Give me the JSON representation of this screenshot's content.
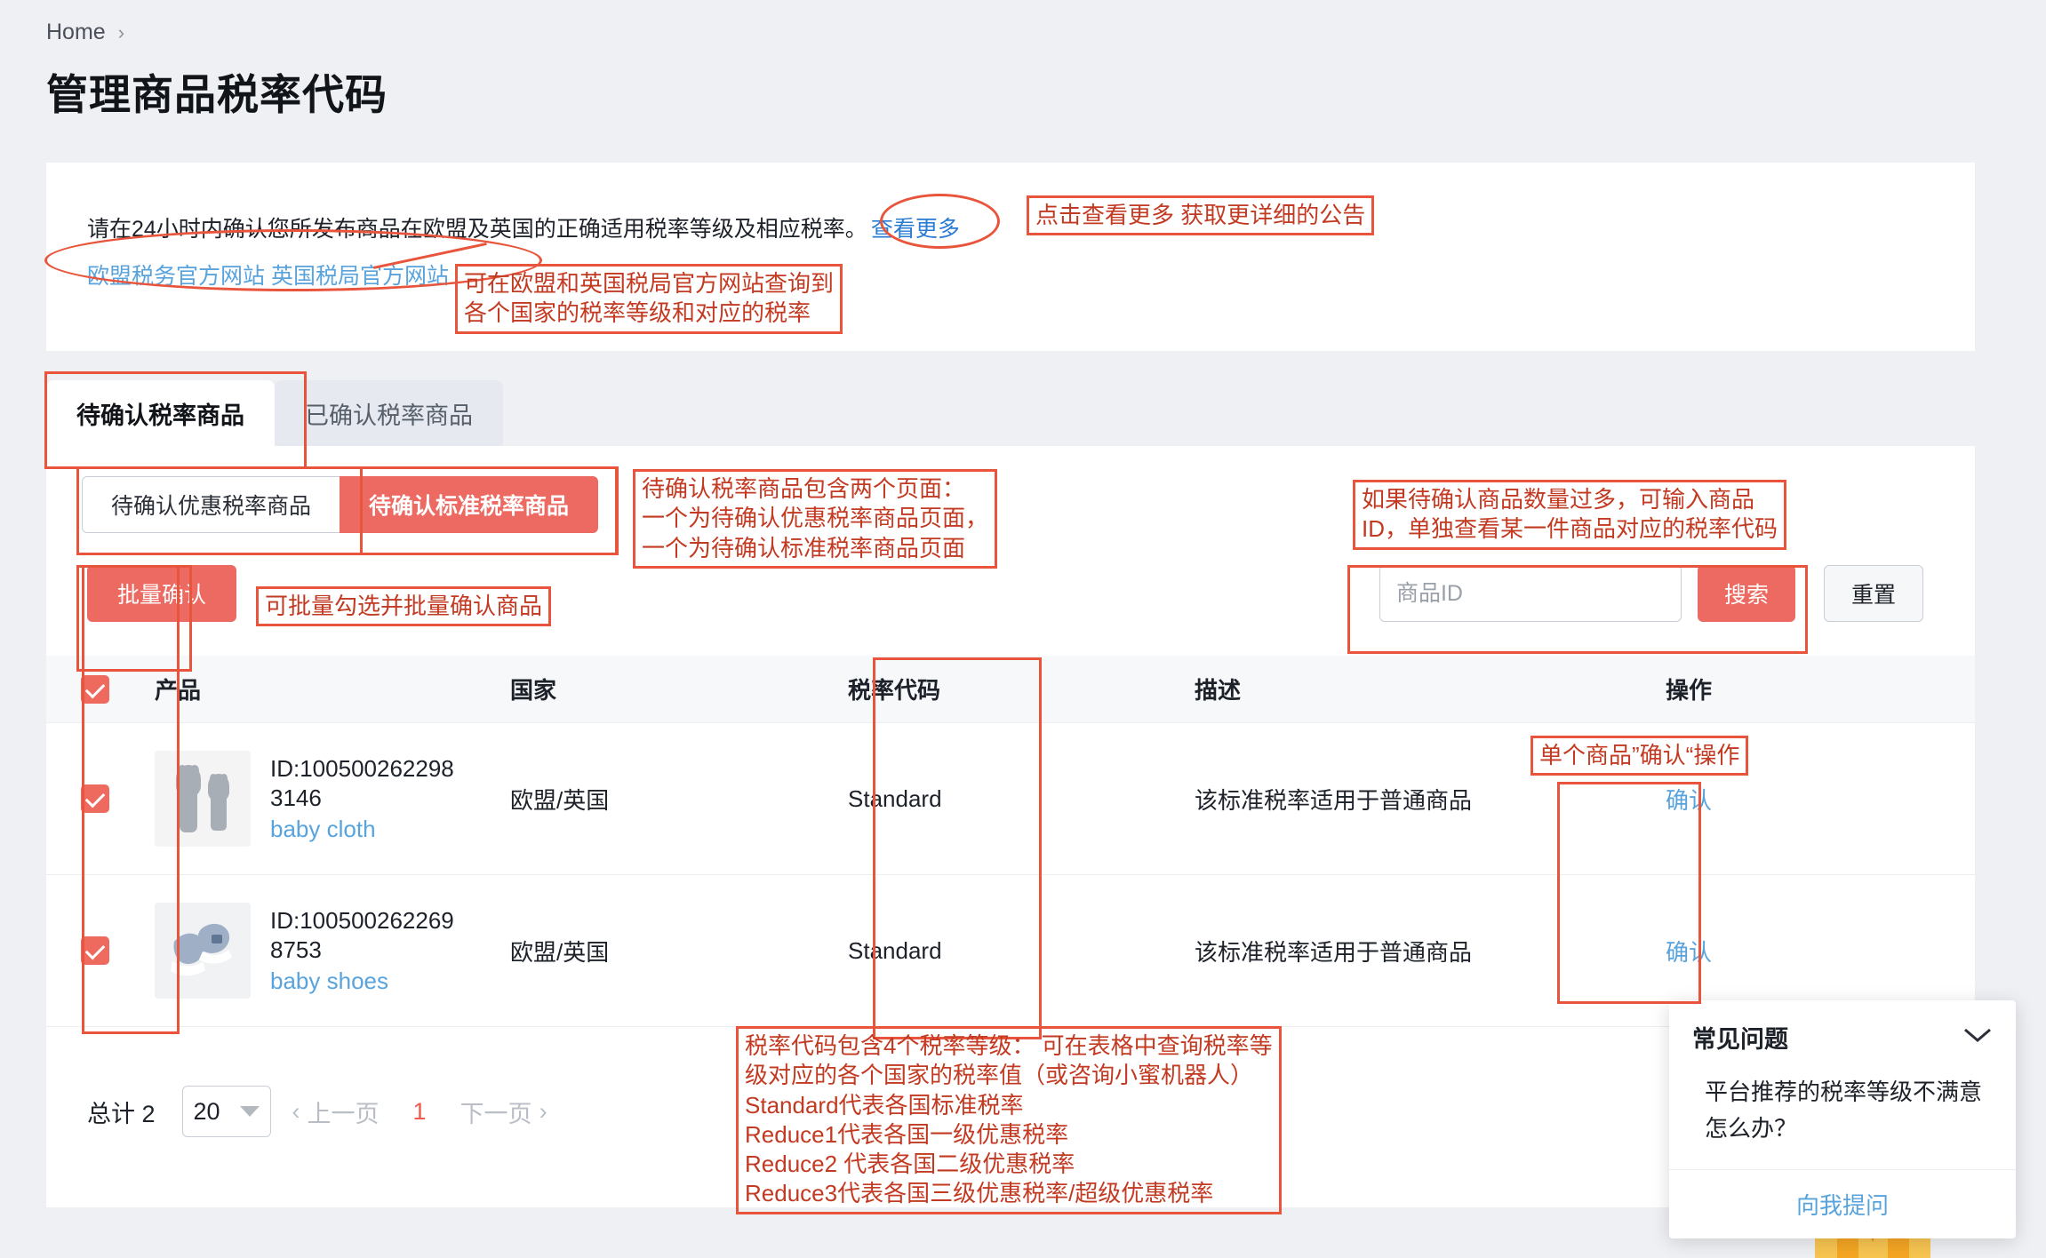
{
  "breadcrumb": {
    "home": "Home",
    "chevron": "›"
  },
  "page_title": "管理商品税率代码",
  "notice": {
    "text": "请在24小时内确认您所发布商品在欧盟及英国的正确适用税率等级及相应税率。",
    "more_link": "查看更多",
    "link_eu": "欧盟税务官方网站",
    "link_uk": "英国税局官方网站"
  },
  "tabs": [
    {
      "label": "待确认税率商品",
      "active": true
    },
    {
      "label": "已确认税率商品",
      "active": false
    }
  ],
  "subtabs": [
    {
      "label": "待确认优惠税率商品",
      "active": false
    },
    {
      "label": "待确认标准税率商品",
      "active": true
    }
  ],
  "toolbar": {
    "batch_confirm": "批量确认",
    "search_placeholder": "商品ID",
    "search_value": "",
    "search_button": "搜索",
    "reset_button": "重置"
  },
  "table": {
    "columns": [
      "产品",
      "国家",
      "税率代码",
      "描述",
      "操作"
    ],
    "rows": [
      {
        "checked": true,
        "id_label": "ID:1005002622983146",
        "name": "baby cloth",
        "country": "欧盟/英国",
        "tax_code": "Standard",
        "description": "该标准税率适用于普通商品",
        "action": "确认"
      },
      {
        "checked": true,
        "id_label": "ID:1005002622698753",
        "name": "baby shoes",
        "country": "欧盟/英国",
        "tax_code": "Standard",
        "description": "该标准税率适用于普通商品",
        "action": "确认"
      }
    ],
    "header_checked": true
  },
  "pagination": {
    "total_label": "总计 2",
    "page_size": "20",
    "prev": "上一页",
    "current_page": "1",
    "next": "下一页"
  },
  "faq": {
    "title": "常见问题",
    "question": "平台推荐的税率等级不满意怎么办？",
    "ask_link": "向我提问"
  },
  "annotations": {
    "a1": "点击查看更多 获取更详细的公告",
    "a2": "可在欧盟和英国税局官方网站查询到\n各个国家的税率等级和对应的税率",
    "a3": "待确认税率商品包含两个页面：\n一个为待确认优惠税率商品页面，\n一个为待确认标准税率商品页面",
    "a4": "如果待确认商品数量过多，可输入商品\nID，单独查看某一件商品对应的税率代码",
    "a5": "可批量勾选并批量确认商品",
    "a6": "单个商品”确认“操作",
    "a7": "税率代码包含4个税率等级： 可在表格中查询税率等\n级对应的各个国家的税率值（或咨询小蜜机器人）\nStandard代表各国标准税率\nReduce1代表各国一级优惠税率\nReduce2 代表各国二级优惠税率\nReduce3代表各国三级优惠税率/超级优惠税率"
  },
  "colors": {
    "accent": "#ec6a61",
    "link": "#59a3dd",
    "annotation": "#e8553c",
    "page_bg": "#eef0f4"
  }
}
